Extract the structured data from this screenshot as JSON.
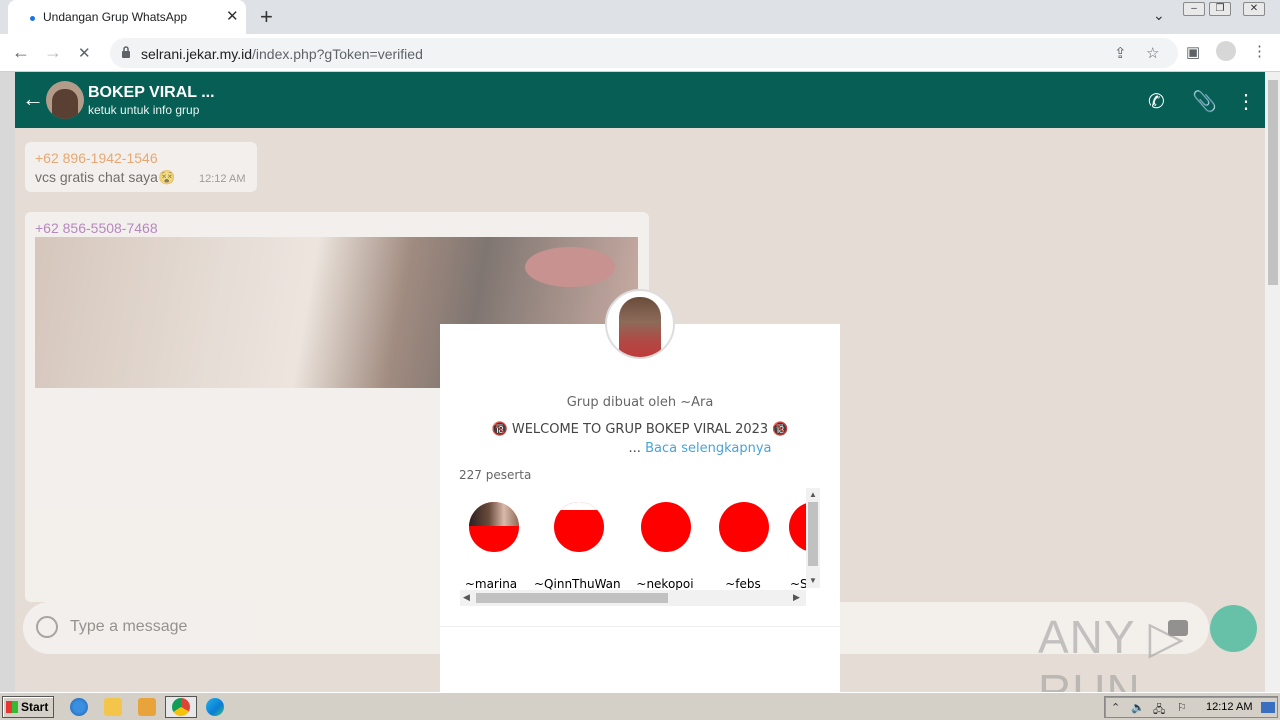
{
  "browser": {
    "tab_title": "Undangan Grup WhatsApp",
    "tab_close": "✕",
    "new_tab": "+",
    "url_host": "selrani.jekar.my.id",
    "url_path": "/index.php?gToken=verified",
    "nav_back": "←",
    "nav_forward": "→",
    "nav_reload": "✕"
  },
  "header": {
    "back": "←",
    "title": "BOKEP VIRAL ...",
    "subtitle": "ketuk untuk info grup"
  },
  "chat": {
    "messages": [
      {
        "sender": "+62 896-1942-1546",
        "text": "vcs gratis chat saya😵",
        "time": "12:12 AM"
      },
      {
        "sender": "+62 856-5508-7468"
      }
    ],
    "input_placeholder": "Type a message"
  },
  "modal": {
    "created_by": "Grup dibuat oleh ~Ara",
    "description": "🔞 WELCOME TO GRUP BOKEP VIRAL 2023 🔞",
    "ellipsis": "...",
    "read_more": "Baca selengkapnya",
    "participants": "227 peserta",
    "members": [
      {
        "name": "~marina"
      },
      {
        "name": "~QinnThuWan"
      },
      {
        "name": "~nekopoi"
      },
      {
        "name": "~febs"
      },
      {
        "name": "~S"
      }
    ]
  },
  "watermark": "ANY ▷ RUN",
  "taskbar": {
    "start_label": "Start",
    "time": "12:12 AM"
  },
  "colors": {
    "whatsapp_header": "#075e54",
    "member_avatar": "#ff0000",
    "link": "#4aa3d8"
  }
}
